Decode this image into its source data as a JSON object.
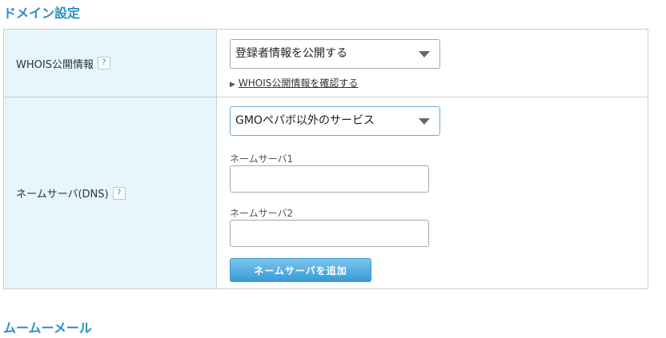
{
  "sections": {
    "domain_title": "ドメイン設定",
    "mumu_title": "ムームーメール"
  },
  "whois": {
    "label": "WHOIS公開情報",
    "help": "?",
    "select_value": "登録者情報を公開する",
    "link_marker": "▶",
    "link_text": "WHOIS公開情報を確認する"
  },
  "nameserver": {
    "label": "ネームサーバ(DNS)",
    "help": "?",
    "select_value": "GMOペパボ以外のサービス",
    "field1_label": "ネームサーバ1",
    "field1_value": "",
    "field2_label": "ネームサーバ2",
    "field2_value": "",
    "add_button_label": "ネームサーバを追加"
  },
  "colors": {
    "accent": "#2a8fc7",
    "label_bg": "#e6f6fb",
    "button": "#3a9ad5"
  },
  "icons": {
    "dropdown": "chevron-down-icon",
    "help": "question-icon"
  }
}
